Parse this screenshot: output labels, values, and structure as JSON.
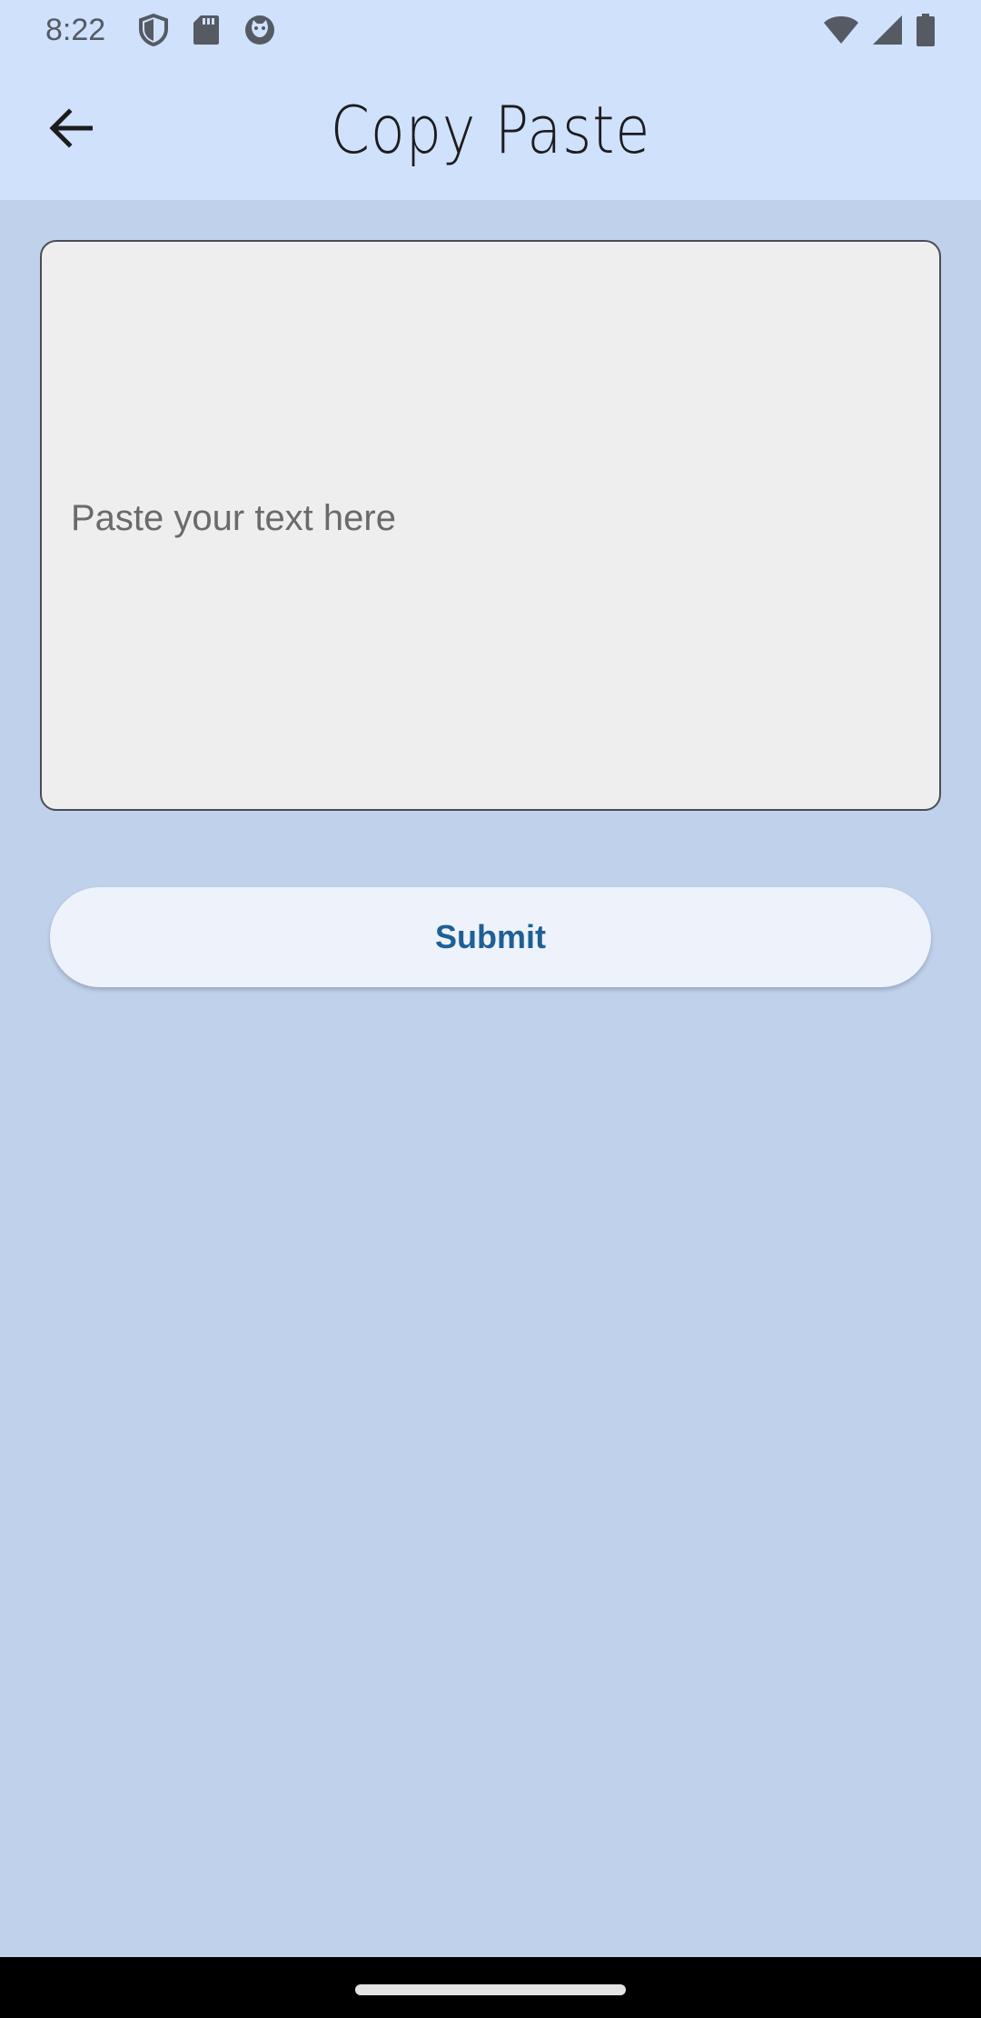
{
  "status_bar": {
    "time": "8:22",
    "left_icons": [
      "shield-icon",
      "sd-card-icon",
      "cat-face-icon"
    ],
    "right_icons": [
      "wifi-icon",
      "cell-signal-icon",
      "battery-icon"
    ]
  },
  "app_bar": {
    "back_icon": "arrow-left-icon",
    "title": "Copy Paste"
  },
  "form": {
    "text_placeholder": "Paste your text here",
    "text_value": "",
    "submit_label": "Submit"
  },
  "colors": {
    "app_bar_bg": "#d0e1fc",
    "page_bg": "#c0d1ec",
    "field_bg": "#eeeeee",
    "button_bg": "#eef3fb",
    "button_text": "#1e6096"
  }
}
